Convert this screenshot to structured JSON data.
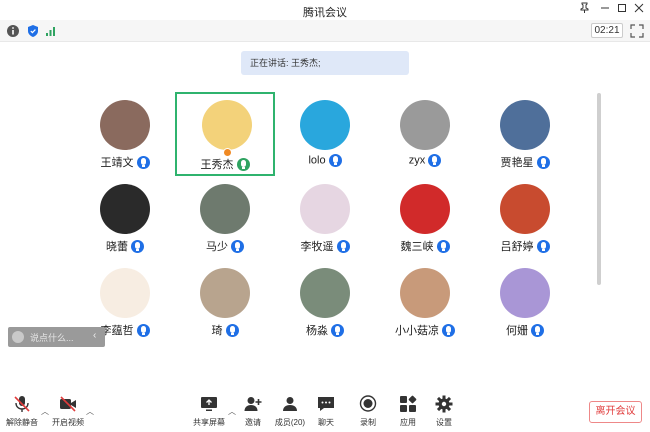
{
  "window": {
    "title": "腾讯会议"
  },
  "status": {
    "timer": "02:21"
  },
  "speaking": "正在讲话: 王秀杰;",
  "participants": [
    {
      "name": "王靖文",
      "bg": "#8a6a5e",
      "mic": "blue"
    },
    {
      "name": "王秀杰",
      "bg": "#f3d27a",
      "mic": "green",
      "active": true
    },
    {
      "name": "lolo",
      "bg": "#29a7dd",
      "mic": "blue"
    },
    {
      "name": "zyx",
      "bg": "#9a9a9a",
      "mic": "blue"
    },
    {
      "name": "贾艳星",
      "bg": "#4f6f9a",
      "mic": "blue"
    },
    {
      "name": "晓蕾",
      "bg": "#2a2a2a",
      "mic": "blue"
    },
    {
      "name": "马少",
      "bg": "#6e7a6e",
      "mic": "blue"
    },
    {
      "name": "李牧遥",
      "bg": "#e6d6e2",
      "mic": "blue"
    },
    {
      "name": "魏三峡",
      "bg": "#d12a2a",
      "mic": "blue"
    },
    {
      "name": "吕舒婷",
      "bg": "#c84b2f",
      "mic": "blue"
    },
    {
      "name": "李蕴哲",
      "bg": "#f7ede2",
      "mic": "blue"
    },
    {
      "name": "琦",
      "bg": "#b8a48e",
      "mic": "blue"
    },
    {
      "name": "杨淼",
      "bg": "#7a8c7a",
      "mic": "blue"
    },
    {
      "name": "小小菇凉",
      "bg": "#c89a7a",
      "mic": "blue"
    },
    {
      "name": "何姗",
      "bg": "#a996d6",
      "mic": "blue"
    }
  ],
  "chat": {
    "placeholder": "说点什么..."
  },
  "toolbar": {
    "unmute": "解除静音",
    "video": "开启视频",
    "share": "共享屏幕",
    "invite": "邀请",
    "members": "成员(20)",
    "chat": "聊天",
    "record": "录制",
    "apps": "应用",
    "settings": "设置",
    "leave": "离开会议"
  },
  "colors": {
    "accent": "#1f6fe6",
    "active_border": "#2fb36e",
    "leave": "#e03b3b"
  }
}
